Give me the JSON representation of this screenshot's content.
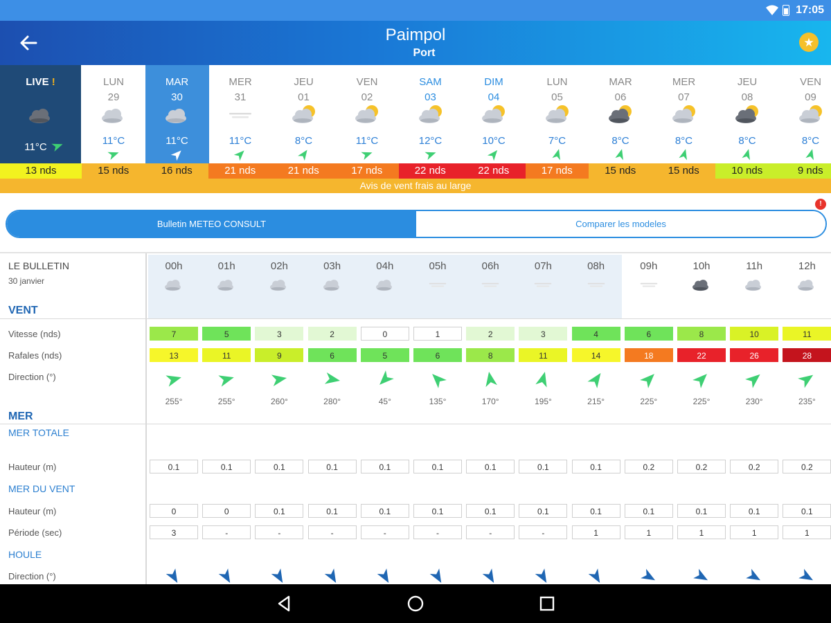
{
  "statusbar": {
    "time": "17:05"
  },
  "header": {
    "title": "Paimpol",
    "subtitle": "Port"
  },
  "live": {
    "label": "LIVE",
    "excl": "!",
    "temp": "11°C",
    "wind_deg": 250,
    "icon": "cloudy-dark-icon"
  },
  "days": [
    {
      "name": "LUN",
      "num": "29",
      "temp": "11°C",
      "icon": "cloudy-icon",
      "wind_deg": 250,
      "selected": false,
      "weekend": false
    },
    {
      "name": "MAR",
      "num": "30",
      "temp": "11°C",
      "icon": "cloudy-icon",
      "wind_deg": 225,
      "selected": true,
      "weekend": false
    },
    {
      "name": "MER",
      "num": "31",
      "temp": "11°C",
      "icon": "fog-icon",
      "wind_deg": 225,
      "selected": false,
      "weekend": false
    },
    {
      "name": "JEU",
      "num": "01",
      "temp": "8°C",
      "icon": "sun-cloud-icon",
      "wind_deg": 215,
      "selected": false,
      "weekend": false
    },
    {
      "name": "VEN",
      "num": "02",
      "temp": "11°C",
      "icon": "sun-cloud-icon",
      "wind_deg": 250,
      "selected": false,
      "weekend": false
    },
    {
      "name": "SAM",
      "num": "03",
      "temp": "12°C",
      "icon": "sun-cloud-icon",
      "wind_deg": 250,
      "selected": false,
      "weekend": true
    },
    {
      "name": "DIM",
      "num": "04",
      "temp": "10°C",
      "icon": "sun-cloud-icon",
      "wind_deg": 220,
      "selected": false,
      "weekend": true
    },
    {
      "name": "LUN",
      "num": "05",
      "temp": "7°C",
      "icon": "sun-cloud-icon",
      "wind_deg": 195,
      "selected": false,
      "weekend": false
    },
    {
      "name": "MAR",
      "num": "06",
      "temp": "8°C",
      "icon": "sun-dark-cloud-icon",
      "wind_deg": 195,
      "selected": false,
      "weekend": false
    },
    {
      "name": "MER",
      "num": "07",
      "temp": "8°C",
      "icon": "sun-cloud-icon",
      "wind_deg": 195,
      "selected": false,
      "weekend": false
    },
    {
      "name": "JEU",
      "num": "08",
      "temp": "8°C",
      "icon": "sun-dark-cloud-icon",
      "wind_deg": 195,
      "selected": false,
      "weekend": false
    },
    {
      "name": "VEN",
      "num": "09",
      "temp": "8°C",
      "icon": "sun-cloud-icon",
      "wind_deg": 195,
      "selected": false,
      "weekend": false
    }
  ],
  "knots": [
    {
      "label": "13 nds",
      "color": "#f2f21f"
    },
    {
      "label": "15 nds",
      "color": "#f5b62e"
    },
    {
      "label": "16 nds",
      "color": "#f5b62e"
    },
    {
      "label": "21 nds",
      "color": "#f47a20"
    },
    {
      "label": "21 nds",
      "color": "#f47a20"
    },
    {
      "label": "17 nds",
      "color": "#f47a20"
    },
    {
      "label": "22 nds",
      "color": "#e8222a"
    },
    {
      "label": "22 nds",
      "color": "#e8222a"
    },
    {
      "label": "17 nds",
      "color": "#f47a20"
    },
    {
      "label": "15 nds",
      "color": "#f5b62e"
    },
    {
      "label": "15 nds",
      "color": "#f5b62e"
    },
    {
      "label": "10 nds",
      "color": "#c9ee2a"
    },
    {
      "label": "9 nds",
      "color": "#c9ee2a"
    }
  ],
  "advisory": "Avis de vent frais au large",
  "tabs": {
    "bulletin": "Bulletin METEO CONSULT",
    "compare": "Comparer les modeles",
    "badge": "!"
  },
  "bulletin": {
    "title": "LE BULLETIN",
    "date": "30 janvier",
    "sections": {
      "vent": "VENT",
      "vitesse": "Vitesse (nds)",
      "rafales": "Rafales (nds)",
      "direction": "Direction (°)",
      "mer": "MER",
      "mer_totale": "MER TOTALE",
      "hauteur": "Hauteur (m)",
      "mer_du_vent": "MER DU VENT",
      "hauteur2": "Hauteur (m)",
      "periode": "Période (sec)",
      "houle": "HOULE",
      "direction2": "Direction (°)"
    },
    "hours": [
      "00h",
      "01h",
      "02h",
      "03h",
      "04h",
      "05h",
      "06h",
      "07h",
      "08h",
      "09h",
      "10h",
      "11h",
      "12h"
    ],
    "hour_icons": [
      "cloudy-icon",
      "cloudy-icon",
      "cloudy-icon",
      "cloudy-icon",
      "cloudy-icon",
      "fog-icon",
      "fog-icon",
      "fog-icon",
      "fog-icon",
      "fog-icon",
      "cloudy-dark-icon",
      "cloudy-icon",
      "cloudy-icon"
    ],
    "speed": [
      {
        "v": "7",
        "c": "#9be84a"
      },
      {
        "v": "5",
        "c": "#6fe35a"
      },
      {
        "v": "3",
        "c": "#e2f8d4"
      },
      {
        "v": "2",
        "c": "#e2f8d4"
      },
      {
        "v": "0",
        "c": "#ffffff"
      },
      {
        "v": "1",
        "c": "#ffffff"
      },
      {
        "v": "2",
        "c": "#e2f8d4"
      },
      {
        "v": "3",
        "c": "#e2f8d4"
      },
      {
        "v": "4",
        "c": "#6fe35a"
      },
      {
        "v": "6",
        "c": "#6fe35a"
      },
      {
        "v": "8",
        "c": "#9be84a"
      },
      {
        "v": "10",
        "c": "#d9f226"
      },
      {
        "v": "11",
        "c": "#eaf526"
      }
    ],
    "gusts": [
      {
        "v": "13",
        "c": "#f6f62a"
      },
      {
        "v": "11",
        "c": "#eaf526"
      },
      {
        "v": "9",
        "c": "#c9ee2a"
      },
      {
        "v": "6",
        "c": "#6fe35a"
      },
      {
        "v": "5",
        "c": "#6fe35a"
      },
      {
        "v": "6",
        "c": "#6fe35a"
      },
      {
        "v": "8",
        "c": "#9be84a"
      },
      {
        "v": "11",
        "c": "#eaf526"
      },
      {
        "v": "14",
        "c": "#f6f62a"
      },
      {
        "v": "18",
        "c": "#f47a20"
      },
      {
        "v": "22",
        "c": "#e8222a"
      },
      {
        "v": "26",
        "c": "#e8222a"
      },
      {
        "v": "28",
        "c": "#c4141d"
      }
    ],
    "direction_deg": [
      "255°",
      "255°",
      "260°",
      "280°",
      "45°",
      "135°",
      "170°",
      "195°",
      "215°",
      "225°",
      "225°",
      "230°",
      "235°"
    ],
    "direction_val": [
      255,
      255,
      260,
      280,
      45,
      135,
      170,
      195,
      215,
      225,
      225,
      230,
      235
    ],
    "mer_totale_h": [
      "0.1",
      "0.1",
      "0.1",
      "0.1",
      "0.1",
      "0.1",
      "0.1",
      "0.1",
      "0.1",
      "0.2",
      "0.2",
      "0.2",
      "0.2"
    ],
    "mer_vent_h": [
      "0",
      "0",
      "0.1",
      "0.1",
      "0.1",
      "0.1",
      "0.1",
      "0.1",
      "0.1",
      "0.1",
      "0.1",
      "0.1",
      "0.1"
    ],
    "periode": [
      "3",
      "-",
      "-",
      "-",
      "-",
      "-",
      "-",
      "-",
      "1",
      "1",
      "1",
      "1",
      "1"
    ],
    "houle_dir": [
      330,
      330,
      330,
      330,
      330,
      330,
      330,
      330,
      330,
      300,
      300,
      300,
      300
    ]
  },
  "colors": {
    "accent": "#2b8de0",
    "live_bg": "#1f4a77",
    "advisory": "#f5b62e",
    "arrow_green": "#3ecf73",
    "swell_blue": "#1f66b3"
  }
}
